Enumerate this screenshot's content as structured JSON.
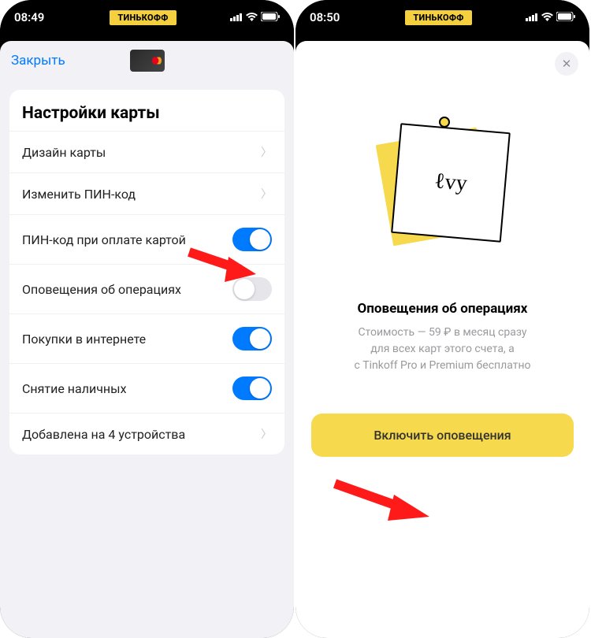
{
  "left": {
    "status": {
      "time": "08:49",
      "brand": "ТИНЬКОФФ"
    },
    "close": "Закрыть",
    "group_title": "Настройки карты",
    "rows": [
      {
        "label": "Дизайн карты",
        "type": "chevron"
      },
      {
        "label": "Изменить ПИН-код",
        "type": "chevron"
      },
      {
        "label": "ПИН-код при оплате картой",
        "type": "toggle",
        "on": true
      },
      {
        "label": "Оповещения об операциях",
        "type": "toggle",
        "on": false
      },
      {
        "label": "Покупки в интернете",
        "type": "toggle",
        "on": true
      },
      {
        "label": "Снятие наличных",
        "type": "toggle",
        "on": true
      },
      {
        "label": "Добавлена на 4 устройства",
        "type": "chevron"
      }
    ]
  },
  "right": {
    "status": {
      "time": "08:50",
      "brand": "ТИНЬКОФФ"
    },
    "title": "Оповещения об операциях",
    "desc_line1": "Стоимость — 59 ₽ в месяц сразу",
    "desc_line2": "для всех карт этого счета, а",
    "desc_line3": "с Tinkoff Pro и Premium бесплатно",
    "button": "Включить оповещения"
  }
}
